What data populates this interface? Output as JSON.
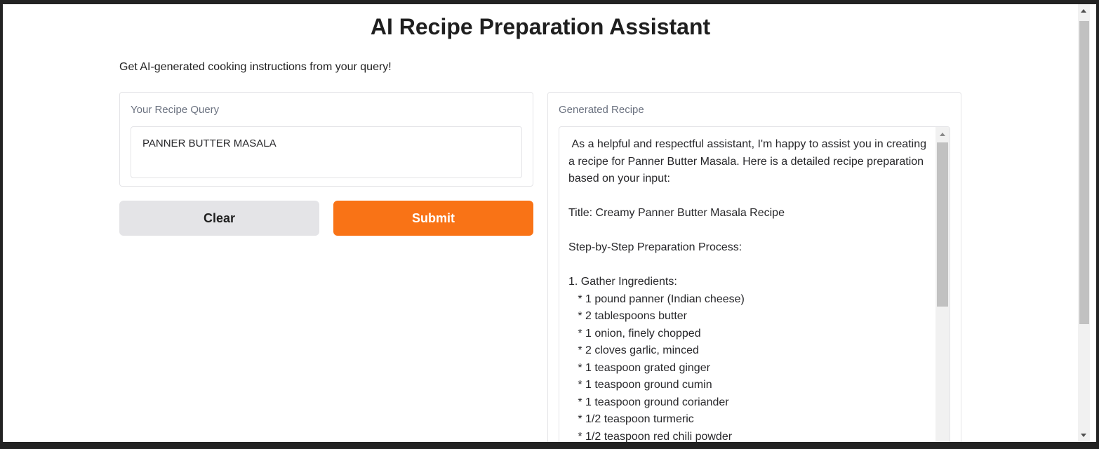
{
  "app": {
    "title": "AI Recipe Preparation Assistant",
    "description": "Get AI-generated cooking instructions from your query!"
  },
  "input": {
    "label": "Your Recipe Query",
    "value": "PANNER BUTTER MASALA"
  },
  "buttons": {
    "clear_label": "Clear",
    "submit_label": "Submit"
  },
  "output": {
    "label": "Generated Recipe",
    "text": " As a helpful and respectful assistant, I'm happy to assist you in creating a recipe for Panner Butter Masala. Here is a detailed recipe preparation based on your input:\n\nTitle: Creamy Panner Butter Masala Recipe\n\nStep-by-Step Preparation Process:\n\n1. Gather Ingredients:\n   * 1 pound panner (Indian cheese)\n   * 2 tablespoons butter\n   * 1 onion, finely chopped\n   * 2 cloves garlic, minced\n   * 1 teaspoon grated ginger\n   * 1 teaspoon ground cumin\n   * 1 teaspoon ground coriander\n   * 1/2 teaspoon turmeric\n   * 1/2 teaspoon red chili powder"
  },
  "colors": {
    "primary": "#f97316",
    "secondary": "#e4e4e7",
    "background": "#ffffff",
    "frame": "#232323"
  }
}
